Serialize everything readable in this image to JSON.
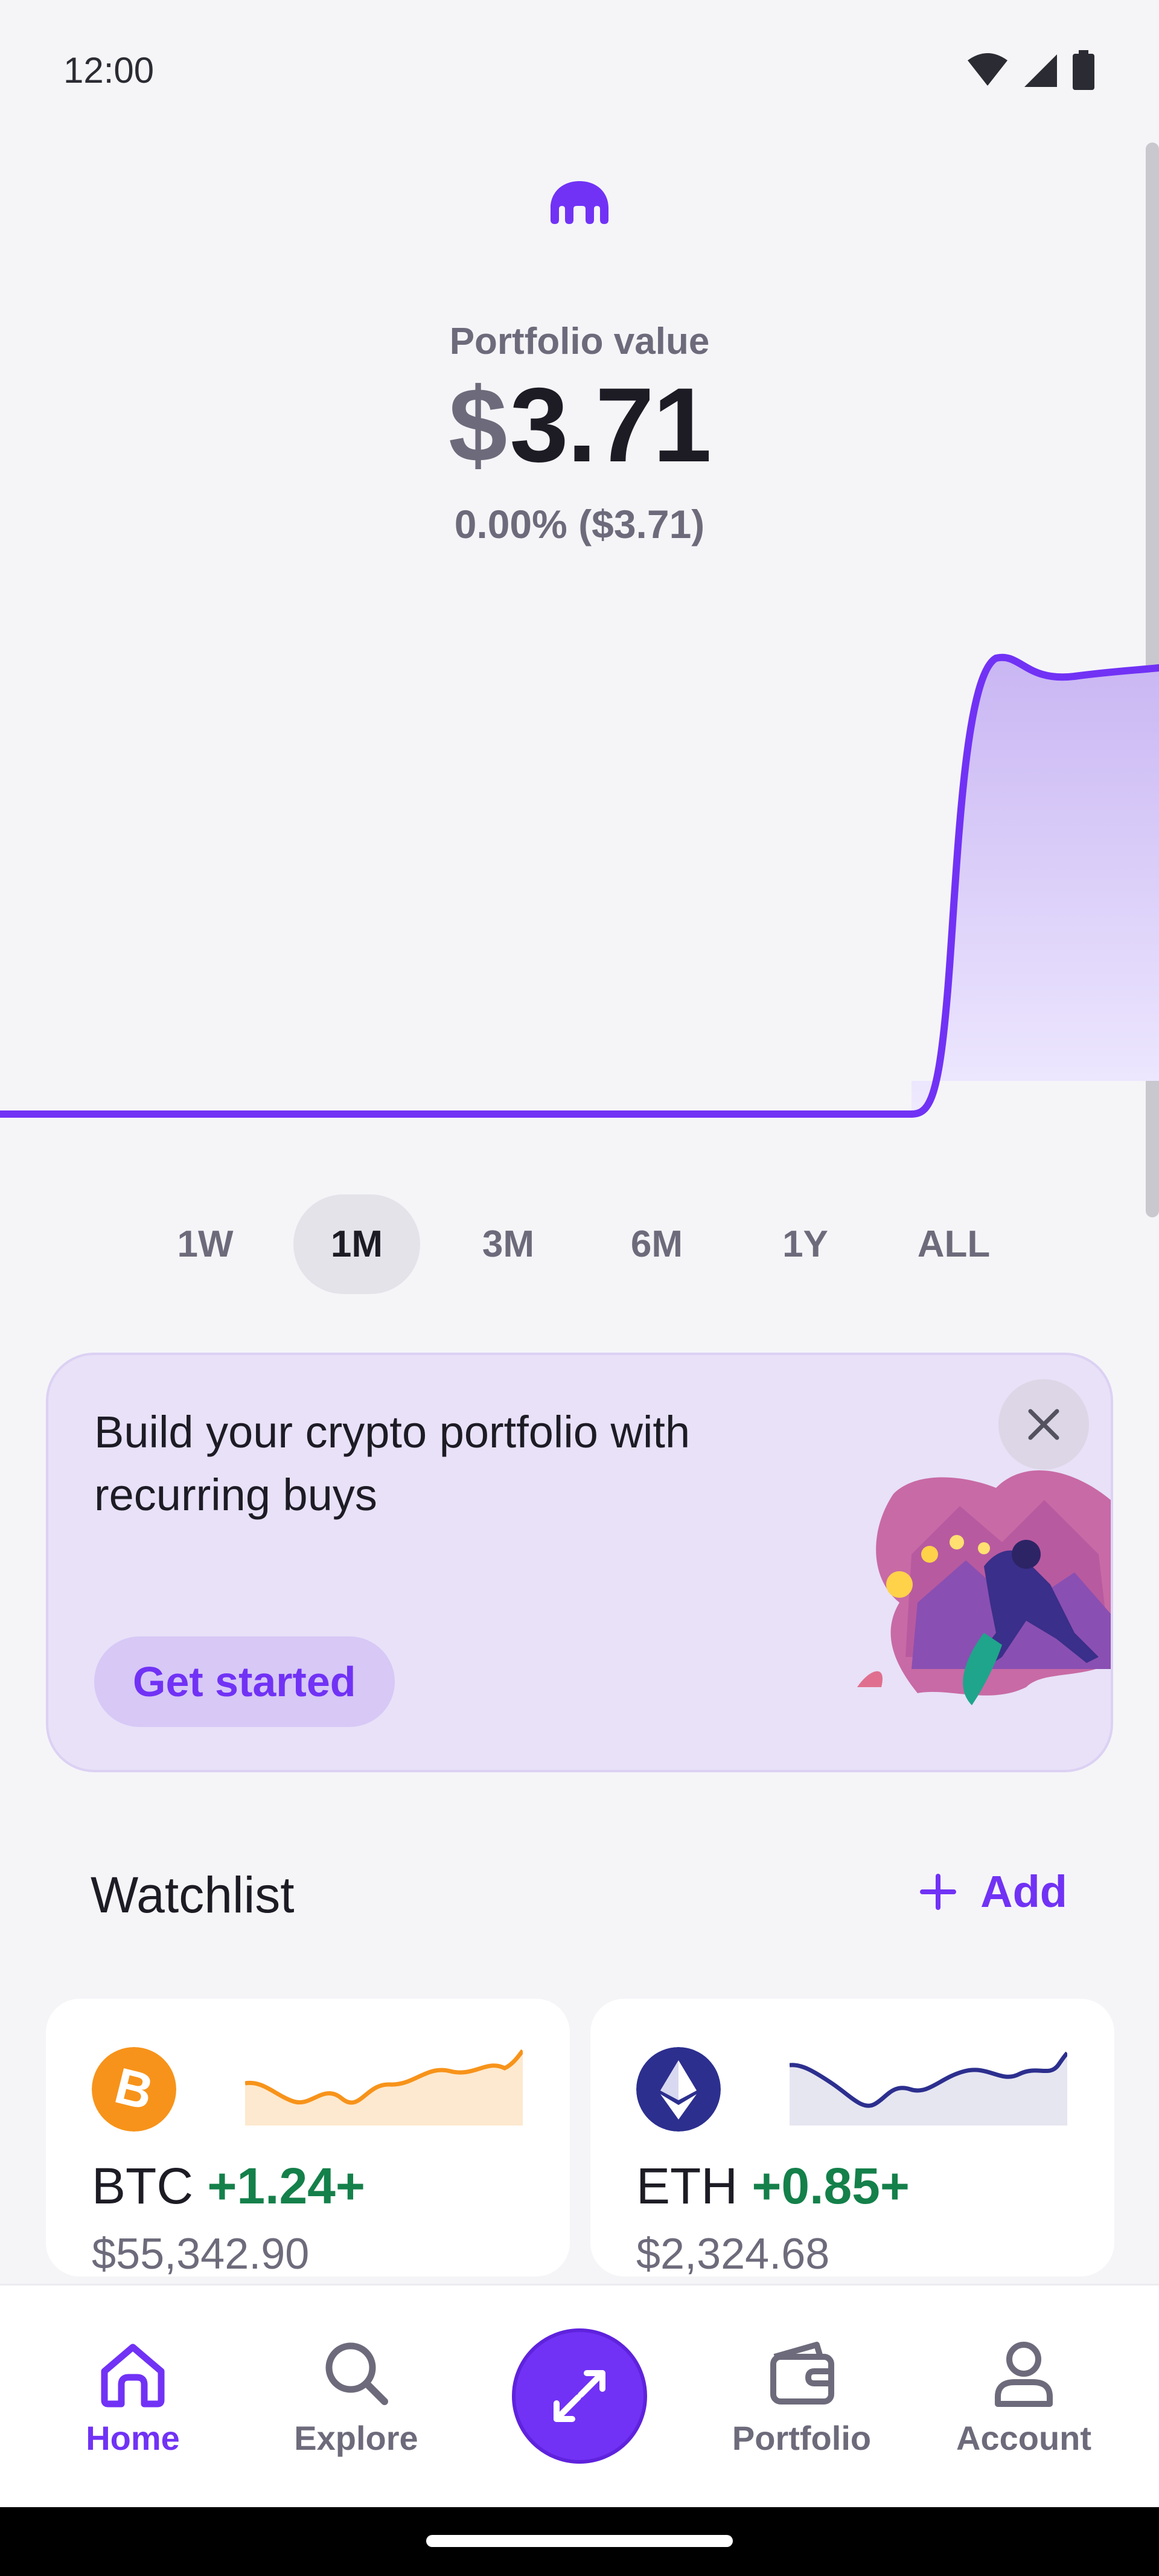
{
  "status_bar": {
    "time": "12:00",
    "icons": [
      "wifi-icon",
      "signal-icon",
      "battery-icon"
    ]
  },
  "brand": {
    "logo_icon": "kraken-logo-icon",
    "accent_color": "#7132f5"
  },
  "portfolio": {
    "label": "Portfolio value",
    "currency_symbol": "$",
    "amount": "3.71",
    "change": "0.00% ($3.71)"
  },
  "time_ranges": {
    "items": [
      "1W",
      "1M",
      "3M",
      "6M",
      "1Y",
      "ALL"
    ],
    "selected": "1M"
  },
  "promo": {
    "title": "Build your crypto portfolio with recurring buys",
    "button_label": "Get started",
    "close_icon": "close-icon"
  },
  "watchlist": {
    "title": "Watchlist",
    "add_label": "Add",
    "items": [
      {
        "symbol": "BTC",
        "change": "+1.24+",
        "price": "$55,342.90",
        "icon": "bitcoin-icon",
        "color": "#f7931a"
      },
      {
        "symbol": "ETH",
        "change": "+0.85+",
        "price": "$2,324.68",
        "icon": "ethereum-icon",
        "color": "#2c2f8e"
      }
    ]
  },
  "bottom_nav": {
    "items": [
      {
        "label": "Home",
        "icon": "home-icon",
        "active": true
      },
      {
        "label": "Explore",
        "icon": "search-icon",
        "active": false
      },
      {
        "label": "Portfolio",
        "icon": "wallet-icon",
        "active": false
      },
      {
        "label": "Account",
        "icon": "person-icon",
        "active": false
      }
    ],
    "trade_icon": "swap-arrows-icon"
  },
  "colors": {
    "positive": "#14804a",
    "muted": "#6d6b7b"
  }
}
